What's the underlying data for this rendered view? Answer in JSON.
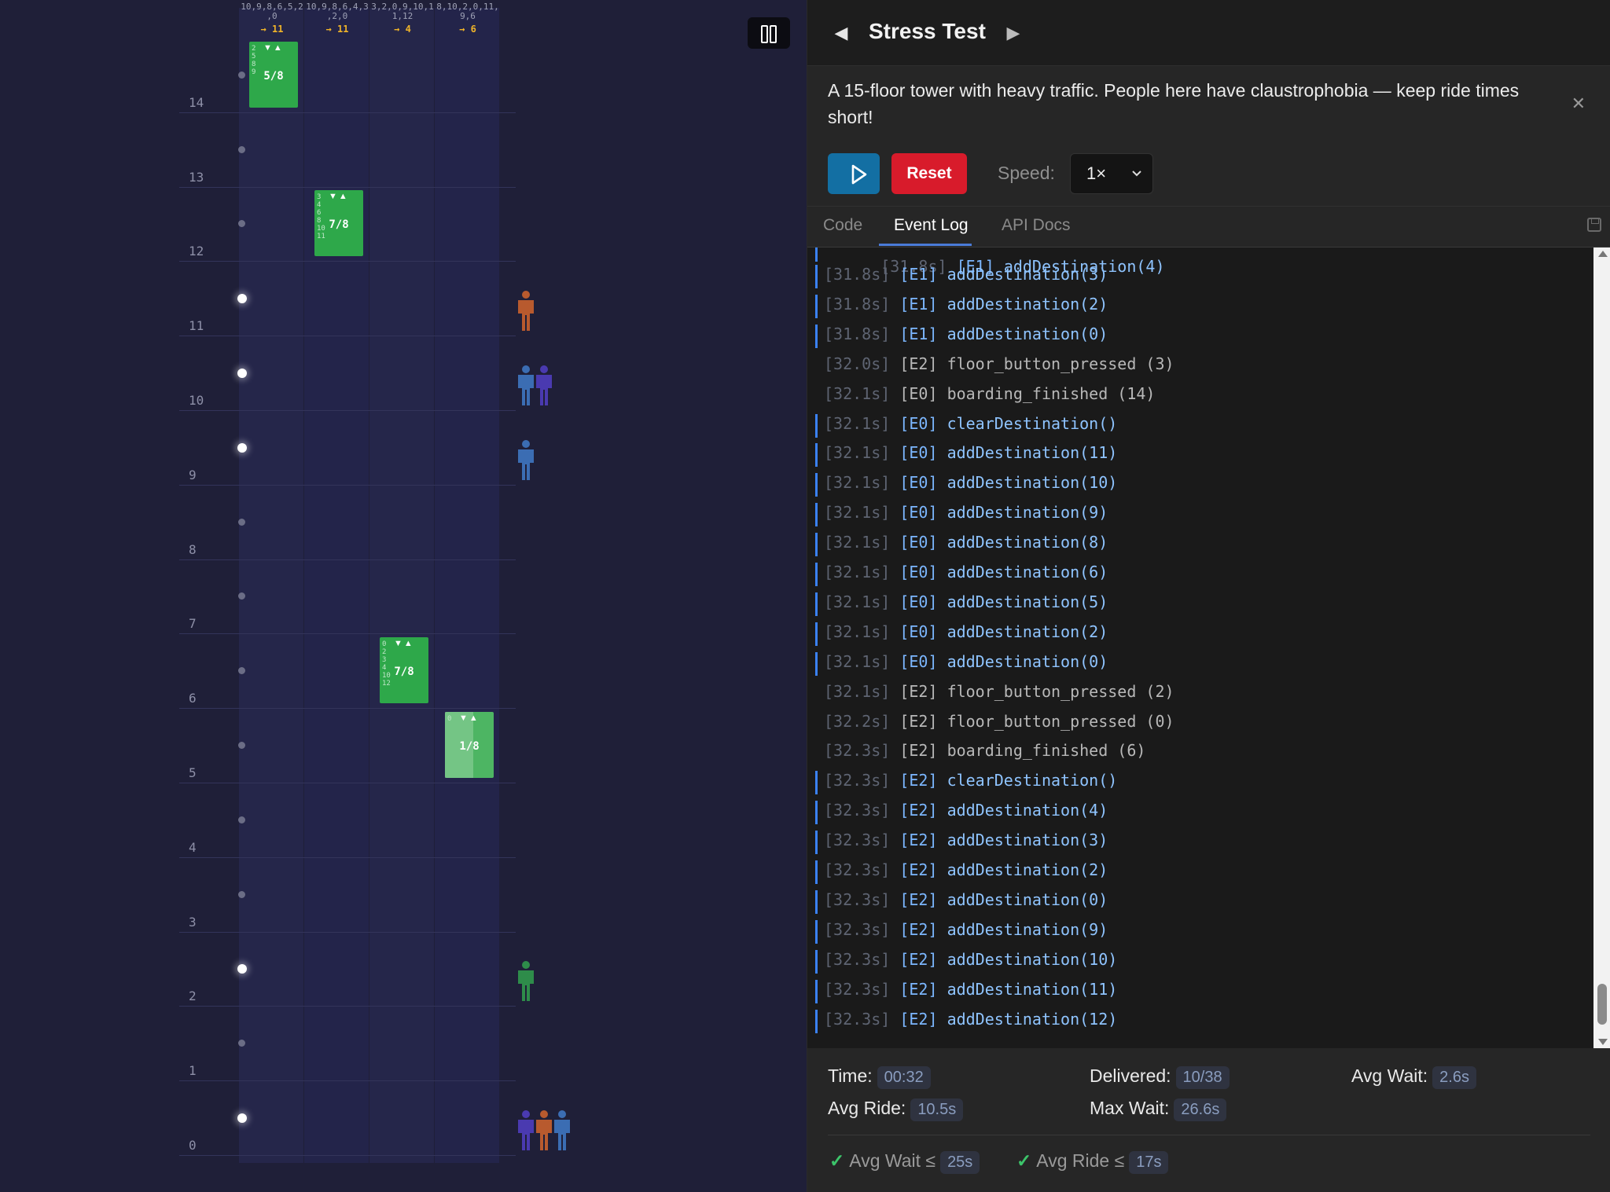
{
  "header": {
    "title": "Stress Test",
    "prev_icon": "◀",
    "next_icon": "▶",
    "description": "A 15-floor tower with heavy traffic. People here have claustrophobia — keep ride times short!",
    "close_icon": "✕"
  },
  "controls": {
    "reset_label": "Reset",
    "speed_label": "Speed:",
    "speed_value": "1×",
    "play_color": "#136fa3",
    "reset_color": "#d81b2b"
  },
  "tabs": [
    {
      "label": "Code"
    },
    {
      "label": "Event Log"
    },
    {
      "label": "API Docs"
    }
  ],
  "log": [
    {
      "time": "[31.8s]",
      "elevator": "[E1]",
      "text": "addDestination(3)",
      "kind": "call"
    },
    {
      "time": "[31.8s]",
      "elevator": "[E1]",
      "text": "addDestination(2)",
      "kind": "call"
    },
    {
      "time": "[31.8s]",
      "elevator": "[E1]",
      "text": "addDestination(0)",
      "kind": "call"
    },
    {
      "time": "[32.0s]",
      "elevator": "[E2]",
      "text": "floor_button_pressed (3)",
      "kind": "event"
    },
    {
      "time": "[32.1s]",
      "elevator": "[E0]",
      "text": "boarding_finished (14)",
      "kind": "event"
    },
    {
      "time": "[32.1s]",
      "elevator": "[E0]",
      "text": "clearDestination()",
      "kind": "call"
    },
    {
      "time": "[32.1s]",
      "elevator": "[E0]",
      "text": "addDestination(11)",
      "kind": "call"
    },
    {
      "time": "[32.1s]",
      "elevator": "[E0]",
      "text": "addDestination(10)",
      "kind": "call"
    },
    {
      "time": "[32.1s]",
      "elevator": "[E0]",
      "text": "addDestination(9)",
      "kind": "call"
    },
    {
      "time": "[32.1s]",
      "elevator": "[E0]",
      "text": "addDestination(8)",
      "kind": "call"
    },
    {
      "time": "[32.1s]",
      "elevator": "[E0]",
      "text": "addDestination(6)",
      "kind": "call"
    },
    {
      "time": "[32.1s]",
      "elevator": "[E0]",
      "text": "addDestination(5)",
      "kind": "call"
    },
    {
      "time": "[32.1s]",
      "elevator": "[E0]",
      "text": "addDestination(2)",
      "kind": "call"
    },
    {
      "time": "[32.1s]",
      "elevator": "[E0]",
      "text": "addDestination(0)",
      "kind": "call"
    },
    {
      "time": "[32.1s]",
      "elevator": "[E2]",
      "text": "floor_button_pressed (2)",
      "kind": "event"
    },
    {
      "time": "[32.2s]",
      "elevator": "[E2]",
      "text": "floor_button_pressed (0)",
      "kind": "event"
    },
    {
      "time": "[32.3s]",
      "elevator": "[E2]",
      "text": "boarding_finished (6)",
      "kind": "event"
    },
    {
      "time": "[32.3s]",
      "elevator": "[E2]",
      "text": "clearDestination()",
      "kind": "call"
    },
    {
      "time": "[32.3s]",
      "elevator": "[E2]",
      "text": "addDestination(4)",
      "kind": "call"
    },
    {
      "time": "[32.3s]",
      "elevator": "[E2]",
      "text": "addDestination(3)",
      "kind": "call"
    },
    {
      "time": "[32.3s]",
      "elevator": "[E2]",
      "text": "addDestination(2)",
      "kind": "call"
    },
    {
      "time": "[32.3s]",
      "elevator": "[E2]",
      "text": "addDestination(0)",
      "kind": "call"
    },
    {
      "time": "[32.3s]",
      "elevator": "[E2]",
      "text": "addDestination(9)",
      "kind": "call"
    },
    {
      "time": "[32.3s]",
      "elevator": "[E2]",
      "text": "addDestination(10)",
      "kind": "call"
    },
    {
      "time": "[32.3s]",
      "elevator": "[E2]",
      "text": "addDestination(11)",
      "kind": "call"
    },
    {
      "time": "[32.3s]",
      "elevator": "[E2]",
      "text": "addDestination(12)",
      "kind": "call"
    }
  ],
  "stats": {
    "time_label": "Time:",
    "time_value": "00:32",
    "delivered_label": "Delivered:",
    "delivered_value": "10/38",
    "avg_wait_label": "Avg Wait:",
    "avg_wait_value": "2.6s",
    "avg_ride_label": "Avg Ride:",
    "avg_ride_value": "10.5s",
    "max_wait_label": "Max Wait:",
    "max_wait_value": "26.6s"
  },
  "goals": [
    {
      "label": "Avg Wait ≤",
      "value": "25s",
      "met": true
    },
    {
      "label": "Avg Ride ≤",
      "value": "17s",
      "met": true
    }
  ],
  "simulation": {
    "floor_labels": [
      "14",
      "13",
      "12",
      "11",
      "10",
      "9",
      "8",
      "7",
      "6",
      "5",
      "4",
      "3",
      "2",
      "1",
      "0"
    ],
    "lit_call_floors": [
      11,
      10,
      9,
      2,
      0
    ],
    "elevators": [
      {
        "id": "E0",
        "queue": "10,9,8,6,5,2,0",
        "queue_lines": [
          "10,9,8,6,5,2",
          ",0"
        ],
        "target": "→ 11",
        "floor": 14,
        "load": "5/8",
        "dest_digits": [
          "2",
          "5",
          "8",
          "9"
        ]
      },
      {
        "id": "E1",
        "queue": "10,9,8,6,4,3,2,0",
        "queue_lines": [
          "10,9,8,6,4,3",
          ",2,0"
        ],
        "target": "→ 11",
        "floor": 12,
        "load": "7/8",
        "dest_digits": [
          "3",
          "4",
          "6",
          "8",
          "10",
          "11"
        ]
      },
      {
        "id": "E2",
        "queue": "3,2,0,9,10,11,12",
        "queue_lines": [
          "3,2,0,9,10,1",
          "1,12"
        ],
        "target": "→ 4",
        "floor": 6,
        "load": "7/8",
        "dest_digits": [
          "0",
          "2",
          "3",
          "4",
          "10",
          "12"
        ]
      },
      {
        "id": "E3",
        "queue": "8,10,2,0,11,9,6",
        "queue_lines": [
          "8,10,2,0,11,",
          "9,6"
        ],
        "target": "→ 6",
        "floor": 5,
        "load": "1/8",
        "dest_digits": [
          "0"
        ]
      }
    ],
    "waiting": [
      {
        "floor": 11,
        "people": [
          "#b85a2e"
        ]
      },
      {
        "floor": 10,
        "people": [
          "#3b6db3",
          "#4a3ab0"
        ]
      },
      {
        "floor": 9,
        "people": [
          "#3b6db3"
        ]
      },
      {
        "floor": 2,
        "people": [
          "#2e8c4a"
        ]
      },
      {
        "floor": 0,
        "people": [
          "#4a3ab0",
          "#b85a2e",
          "#3b6db3"
        ]
      }
    ]
  }
}
